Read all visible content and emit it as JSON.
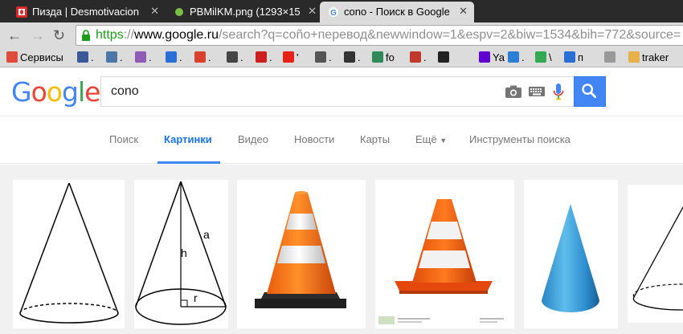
{
  "browser": {
    "tabs": [
      {
        "title": "Пизда | Desmotivacion",
        "icon": "opera-red-icon"
      },
      {
        "title": "PBMilKM.png (1293×15",
        "icon": "image-green-dot-icon"
      },
      {
        "title": "cono - Поиск в Google",
        "icon": "google-g-icon",
        "active": true
      }
    ],
    "url": {
      "scheme": "https",
      "separator": "://",
      "host": "www.google.ru",
      "path": "/search?q=coño+перевод&newwindow=1&espv=2&biw=1534&bih=772&source="
    },
    "bookmarks": [
      {
        "label": "Сервисы",
        "icon": "apps-grid-icon",
        "color": "#e04a3a"
      },
      {
        "label": ".",
        "icon": "facebook-icon",
        "color": "#3b5998"
      },
      {
        "label": ".",
        "icon": "vk-icon",
        "color": "#4a76a8"
      },
      {
        "label": ".",
        "icon": "s-purple-icon",
        "color": "#8e5bb5"
      },
      {
        "label": ".",
        "icon": "sim-icon",
        "color": "#2b6fd6"
      },
      {
        "label": ".",
        "icon": "p-red-icon",
        "color": "#d9412d"
      },
      {
        "label": ".",
        "icon": "d-icon",
        "color": "#444444"
      },
      {
        "label": ".",
        "icon": "opera-icon",
        "color": "#cc1f1f"
      },
      {
        "label": "'",
        "icon": "youtube-icon",
        "color": "#e62117"
      },
      {
        "label": ".",
        "icon": "ghost-icon",
        "color": "#555555"
      },
      {
        "label": ".",
        "icon": "tv-icon",
        "color": "#333333"
      },
      {
        "label": "fo",
        "icon": "planet-icon",
        "color": "#2e8b57"
      },
      {
        "label": ".",
        "icon": "v-red-icon",
        "color": "#c0392b"
      },
      {
        "label": "",
        "icon": "ys-icon",
        "color": "#222222"
      },
      {
        "label": "Ya",
        "icon": "yahoo-mail-icon",
        "color": "#6001d2"
      },
      {
        "label": ".",
        "icon": "ip-icon",
        "color": "#2a7fd4"
      },
      {
        "label": "\\",
        "icon": "play-store-icon",
        "color": "#34a853"
      },
      {
        "label": "п",
        "icon": "chat-icon",
        "color": "#2a6fd6"
      },
      {
        "label": "",
        "icon": "spinner-icon",
        "color": "#999999"
      },
      {
        "label": "traker",
        "icon": "folder-icon",
        "color": "#e8b04a"
      }
    ]
  },
  "google": {
    "logo_letters": [
      {
        "ch": "G",
        "color": "#4285f4"
      },
      {
        "ch": "o",
        "color": "#ea4335"
      },
      {
        "ch": "o",
        "color": "#fbbc05"
      },
      {
        "ch": "g",
        "color": "#4285f4"
      },
      {
        "ch": "l",
        "color": "#34a853"
      },
      {
        "ch": "e",
        "color": "#ea4335"
      }
    ],
    "query": "cono",
    "nav": [
      {
        "label": "Поиск"
      },
      {
        "label": "Картинки",
        "active": true
      },
      {
        "label": "Видео"
      },
      {
        "label": "Новости"
      },
      {
        "label": "Карты"
      },
      {
        "label": "Ещё"
      },
      {
        "label": "Инструменты поиска"
      }
    ]
  },
  "results": {
    "images": [
      {
        "depicts": "cone-line-drawing-icon"
      },
      {
        "depicts": "cone-diagram-with-labels",
        "labels": {
          "slant": "a",
          "height": "h",
          "radius": "r"
        }
      },
      {
        "depicts": "traffic-cone-icon"
      },
      {
        "depicts": "traffic-cone-stock-icon"
      },
      {
        "depicts": "blue-3d-cone-icon"
      },
      {
        "depicts": "cone-partial-drawing-icon"
      }
    ]
  }
}
